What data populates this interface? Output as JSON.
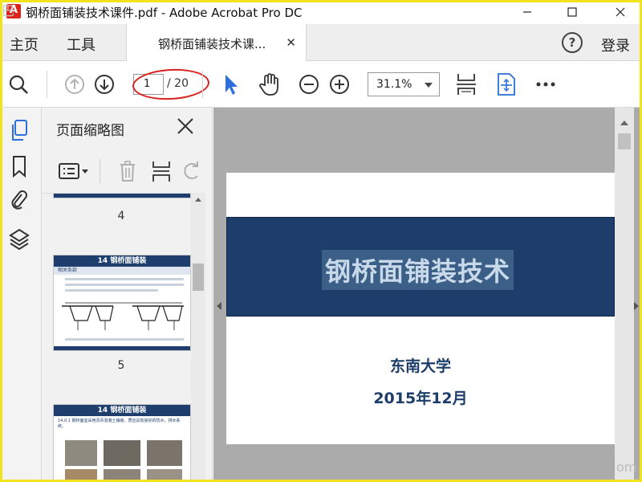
{
  "window": {
    "title": "钢桥面铺装技术课件.pdf - Adobe Acrobat Pro DC",
    "watermark_left": "巴",
    "watermark_right": "om"
  },
  "tabs": {
    "home": "主页",
    "tools": "工具",
    "document": "钢桥面铺装技术课...",
    "close": "✕",
    "help": "?",
    "login": "登录"
  },
  "toolbar": {
    "current_page": "1",
    "total_pages": "/ 20",
    "zoom": "31.1%"
  },
  "thumbnails_panel": {
    "title": "页面缩略图",
    "pages": [
      {
        "number": "4"
      },
      {
        "number": "5",
        "header": "14    钢桥面铺装",
        "subheader": "相关条款"
      },
      {
        "header": "14    钢桥面铺装",
        "bullet": "14.0.1  钢桥面宜采用沥青混凝土铺装，质应具有良好的防水、排水系统。"
      }
    ]
  },
  "document": {
    "title": "钢桥面铺装技术",
    "institution": "东南大学",
    "date": "2015年12月"
  },
  "colors": {
    "accent_blue": "#1d3e6a",
    "title_text": "#c8d9ea",
    "highlight_circle": "#d8201c",
    "frame": "#f2e41c"
  }
}
